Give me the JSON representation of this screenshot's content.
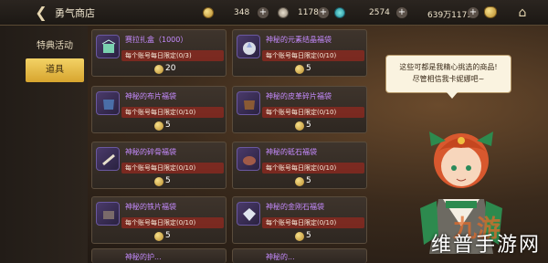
{
  "topbar": {
    "back_icon": "back-arrow-icon",
    "title": "勇气商店",
    "resources": [
      {
        "value": "348",
        "icon": "gold-coin-icon"
      },
      {
        "value": "1178",
        "icon": "ticket-icon"
      },
      {
        "value": "2574",
        "icon": "gem-icon"
      },
      {
        "value": "639万1173",
        "icon": "money-bag-icon"
      }
    ]
  },
  "sidebar": {
    "tabs": [
      {
        "label": "特典活动"
      },
      {
        "label": "道具"
      }
    ]
  },
  "items": [
    {
      "name": "赛拉扎盒（1000）",
      "limit": "每个账号每日限定(0/3)",
      "price": "20"
    },
    {
      "name": "神秘的元素结晶福袋",
      "limit": "每个账号每日限定(0/10)",
      "price": "5"
    },
    {
      "name": "神秘的布片福袋",
      "limit": "每个账号每日限定(0/10)",
      "price": "5"
    },
    {
      "name": "神秘的皮革碎片福袋",
      "limit": "每个账号每日限定(0/10)",
      "price": "5"
    },
    {
      "name": "神秘的碎骨福袋",
      "limit": "每个账号每日限定(0/10)",
      "price": "5"
    },
    {
      "name": "神秘的砥石福袋",
      "limit": "每个账号每日限定(0/10)",
      "price": "5"
    },
    {
      "name": "神秘的铁片福袋",
      "limit": "每个账号每日限定(0/10)",
      "price": "5"
    },
    {
      "name": "神秘的金刚石福袋",
      "limit": "每个账号每日限定(0/10)",
      "price": "5"
    },
    {
      "name": "神秘的护...",
      "limit": "",
      "price": ""
    },
    {
      "name": "神秘的...",
      "limit": "",
      "price": ""
    }
  ],
  "npc": {
    "line1": "这些可都是我精心挑选的商品!",
    "line2": "尽管相信我卡妮娜吧~"
  },
  "watermark": {
    "text": "维普手游网",
    "logo": "九游"
  }
}
